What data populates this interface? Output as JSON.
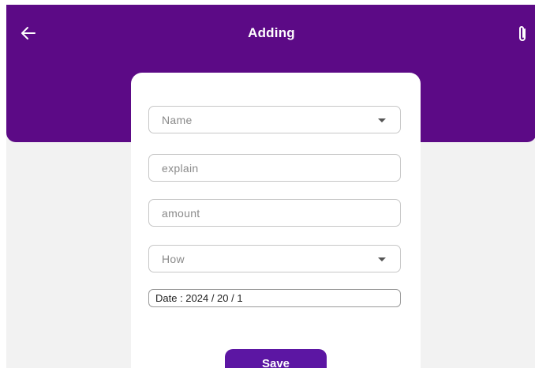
{
  "header": {
    "title": "Adding",
    "back_icon": "arrow-left-icon",
    "attach_icon": "paperclip-icon",
    "background": "#5c0a86"
  },
  "form": {
    "name": {
      "placeholder": "Name",
      "type": "dropdown"
    },
    "explain": {
      "placeholder": "explain"
    },
    "amount": {
      "placeholder": "amount"
    },
    "how": {
      "placeholder": "How",
      "type": "dropdown"
    },
    "date": {
      "text": "Date : 2024 / 20 / 1"
    },
    "save_label": "Save",
    "save_color": "#5c16a3"
  }
}
